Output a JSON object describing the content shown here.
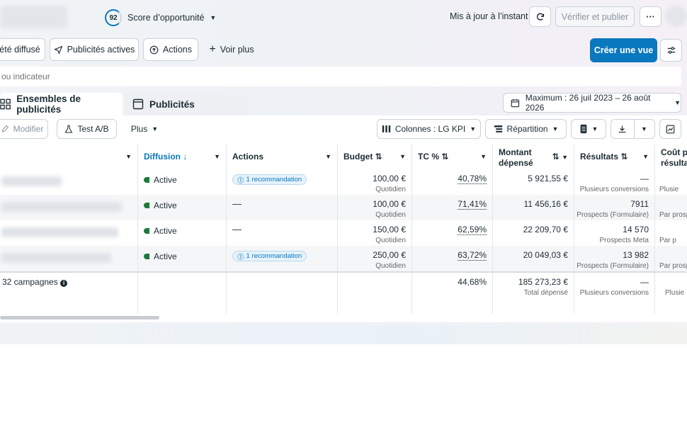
{
  "header": {
    "score_value": "92",
    "score_label": "Score d’opportunité",
    "updated_text": "Mis à jour à l’instant",
    "verify_label": "Vérifier et publier",
    "more_label": "···"
  },
  "filters": {
    "items": [
      "été diffusé",
      "Publicités actives",
      "Actions"
    ],
    "see_more": "Voir plus",
    "create_view": "Créer une vue"
  },
  "search": {
    "placeholder": "ou indicateur"
  },
  "tabs": {
    "adsets": "Ensembles de publicités",
    "ads": "Publicités"
  },
  "date_range": "Maximum : 26 juil 2023 – 26 août 2026",
  "toolbar": {
    "modify": "Modifier",
    "ab_test": "Test A/B",
    "more": "Plus",
    "columns": "Colonnes : LG KPI",
    "breakdown": "Répartition"
  },
  "columns": {
    "diffusion": "Diffusion",
    "actions": "Actions",
    "budget": "Budget",
    "ctr": "TC %",
    "spent_line1": "Montant",
    "spent_line2": "dépensé",
    "results": "Résultats",
    "cost_line1": "Coût pa",
    "cost_line2": "résulta"
  },
  "rows": [
    {
      "status": "Active",
      "action": "1 recommandation",
      "budget": "100,00 €",
      "budget_type": "Quotidien",
      "ctr": "40,78%",
      "spent": "5 921,55 €",
      "result": "—",
      "result_type": "Plusieurs conversions",
      "cost_sub": "Plusie"
    },
    {
      "status": "Active",
      "action": "—",
      "budget": "100,00 €",
      "budget_type": "Quotidien",
      "ctr": "71,41%",
      "spent": "11 456,16 €",
      "result": "7911",
      "result_type": "Prospects (Formulaire)",
      "cost_sub": "Par prosp"
    },
    {
      "status": "Active",
      "action": "—",
      "budget": "150,00 €",
      "budget_type": "Quotidien",
      "ctr": "62,59%",
      "spent": "22 209,70 €",
      "result": "14 570",
      "result_type": "Prospects Meta",
      "cost_sub": "Par p"
    },
    {
      "status": "Active",
      "action": "1 recommandation",
      "budget": "250,00 €",
      "budget_type": "Quotidien",
      "ctr": "63,72%",
      "spent": "20 049,03 €",
      "result": "13 982",
      "result_type": "Prospects (Formulaire)",
      "cost_sub": "Par prosp"
    }
  ],
  "totals": {
    "label": "32 campagnes",
    "ctr": "44,68%",
    "spent": "185 273,23 €",
    "spent_sub": "Total dépensé",
    "result": "—",
    "result_sub": "Plusieurs conversions",
    "cost_sub": "Plusie"
  }
}
